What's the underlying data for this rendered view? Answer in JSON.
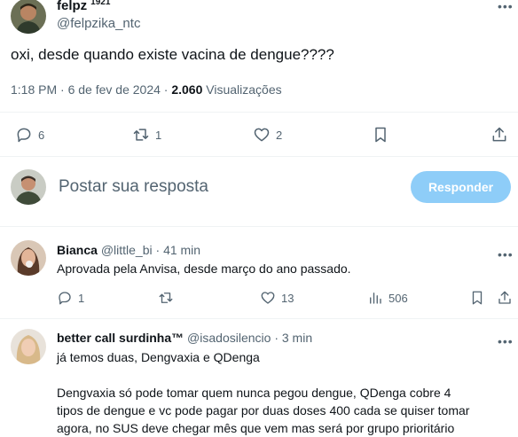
{
  "main_tweet": {
    "display_name": "felpz",
    "badge": "1921",
    "handle": "@felpzika_ntc",
    "text": "oxi, desde quando existe vacina de dengue????",
    "timestamp": "1:18 PM · 6 de fev de 2024 ·",
    "views_count": "2.060",
    "views_label": "Visualizações",
    "actions": {
      "replies": "6",
      "retweets": "1",
      "likes": "2"
    }
  },
  "reply_box": {
    "placeholder": "Postar sua resposta",
    "button_label": "Responder"
  },
  "replies": [
    {
      "display_name": "Bianca",
      "handle": "@little_bi",
      "separator": "·",
      "time": "41 min",
      "text": "Aprovada pela Anvisa, desde março do ano passado.",
      "actions": {
        "replies": "1",
        "retweets": "",
        "likes": "13",
        "views": "506"
      }
    },
    {
      "display_name": "better call surdinha™",
      "handle": "@isadosilencio",
      "separator": "·",
      "time": "3 min",
      "text_lines": [
        "já temos duas, Dengvaxia e QDenga",
        "Dengvaxia só pode tomar quem nunca pegou dengue, QDenga cobre 4",
        "tipos de dengue e vc pode pagar por duas doses 400 cada se quiser tomar",
        "agora, no SUS deve chegar mês que vem mas será por grupo prioritário"
      ]
    }
  ],
  "colors": {
    "text": "#0f1419",
    "muted": "#536471",
    "divider": "#eff3f4",
    "reply_button": "#8ecdf8"
  }
}
